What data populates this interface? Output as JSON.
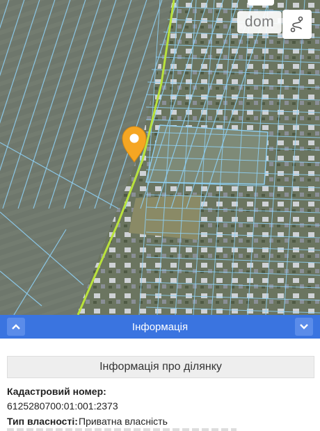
{
  "map": {
    "watermark": "dom",
    "marker_icon": "location-pin-icon",
    "top_button_icon": "route-icon",
    "colors": {
      "parcel_lines": "#8ecff3",
      "road_line": "#b9e23c",
      "marker": "#f5a623"
    }
  },
  "info_bar": {
    "title": "Інформація",
    "collapse_icon": "chevron-up-icon",
    "expand_icon": "chevron-down-icon",
    "color": "#3a74e0"
  },
  "panel": {
    "header": "Інформація про ділянку",
    "cadastral_label": "Кадастровий номер:",
    "cadastral_value": "6125280700:01:001:2373",
    "ownership_label": "Тип власності:",
    "ownership_value": "Приватна власність"
  }
}
